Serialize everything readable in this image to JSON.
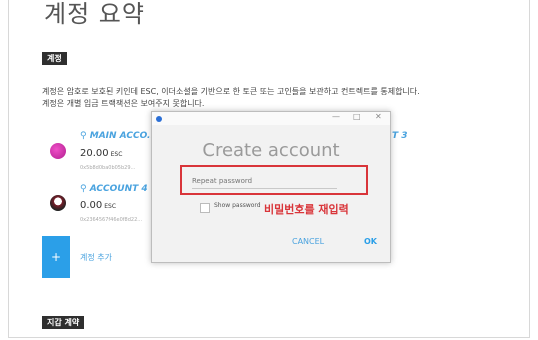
{
  "page": {
    "title": "계정 요약",
    "section_accounts": "계정",
    "desc_line1": "계정은 암호로 보호된 키인데 ESC, 이더소셜을 기반으로 한 토큰 또는 고인들을 보관하고 컨트렉트를 통제합니다.",
    "desc_line2": "계정은 개별 입금 트랙잭션은 보여주지 못합니다.",
    "section_wallets": "지갑 계약"
  },
  "accounts": [
    {
      "name": "MAIN ACCO...",
      "balance": "20.00",
      "unit": "ESC",
      "address": "0x5b8d0ba0b05b29..."
    },
    {
      "name": "ACCOUNT 4",
      "balance": "0.00",
      "unit": "ESC",
      "address": "0x2364567f46e0f8d22..."
    }
  ],
  "partial_account_suffix": "T 3",
  "add_account": {
    "icon": "+",
    "label": "계정 추가"
  },
  "modal": {
    "heading": "Create account",
    "repeat_placeholder": "Repeat password",
    "show_password": "Show password",
    "cancel": "CANCEL",
    "ok": "OK",
    "window_controls": {
      "minimize": "—",
      "maximize": "□",
      "close": "✕"
    }
  },
  "annotation": "비밀번호를 재입력",
  "colors": {
    "accent": "#2b9fe8",
    "annotation": "#d9353a",
    "link": "#4aa3df"
  }
}
